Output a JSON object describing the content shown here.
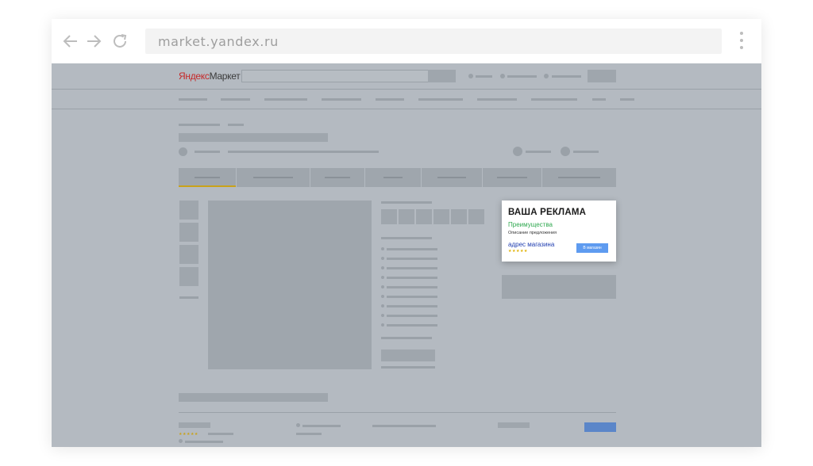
{
  "browser": {
    "url": "market.yandex.ru",
    "icons": {
      "back": "arrow-left-icon",
      "forward": "arrow-right-icon",
      "reload": "reload-icon",
      "menu": "kebab-menu-icon"
    }
  },
  "site": {
    "logo_prefix": "Яндекс",
    "logo_suffix": "Маркет"
  },
  "ad": {
    "title": "ВАША РЕКЛАМА",
    "advantages": "Преимущества",
    "description": "Описание предложения",
    "shop_address": "адрес магазина",
    "rating_stars": "★★★★★",
    "button_label": "В магазин"
  },
  "review": {
    "rating_stars": "★★★★★"
  },
  "colors": {
    "overlay": "#b4bac1",
    "placeholder": "#9fa6ad",
    "accent_green": "#2fa84f",
    "accent_blue": "#5e9bf0",
    "link_blue": "#1f3db0",
    "tab_underline": "#c9a21a",
    "logo_red": "#c62828"
  }
}
